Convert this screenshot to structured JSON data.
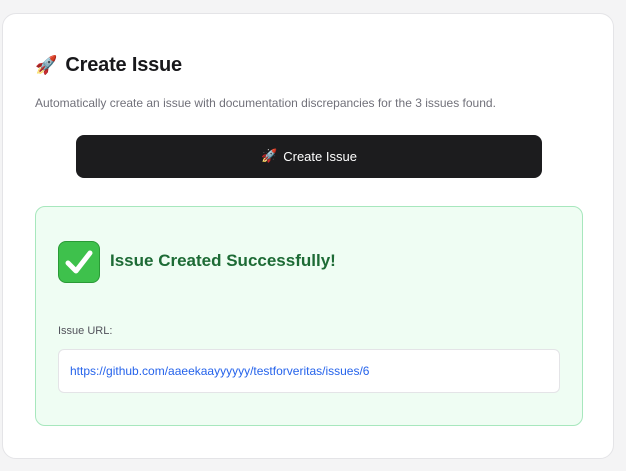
{
  "panel": {
    "title": "Create Issue",
    "description": "Automatically create an issue with documentation discrepancies for the 3 issues found.",
    "title_icon": "rocket-icon"
  },
  "create_button": {
    "label": "Create Issue",
    "icon": "rocket-icon"
  },
  "success": {
    "icon": "check-mark-icon",
    "title": "Issue Created Successfully!",
    "url_label": "Issue URL:",
    "url": "https://github.com/aaeekaayyyyyy/testforveritas/issues/6"
  },
  "colors": {
    "button_bg": "#1c1c1e",
    "success_bg": "#effdf3",
    "success_border": "#a7e7bd",
    "success_text": "#1d6b35",
    "check_green": "#3ec14c",
    "link": "#2563eb"
  }
}
